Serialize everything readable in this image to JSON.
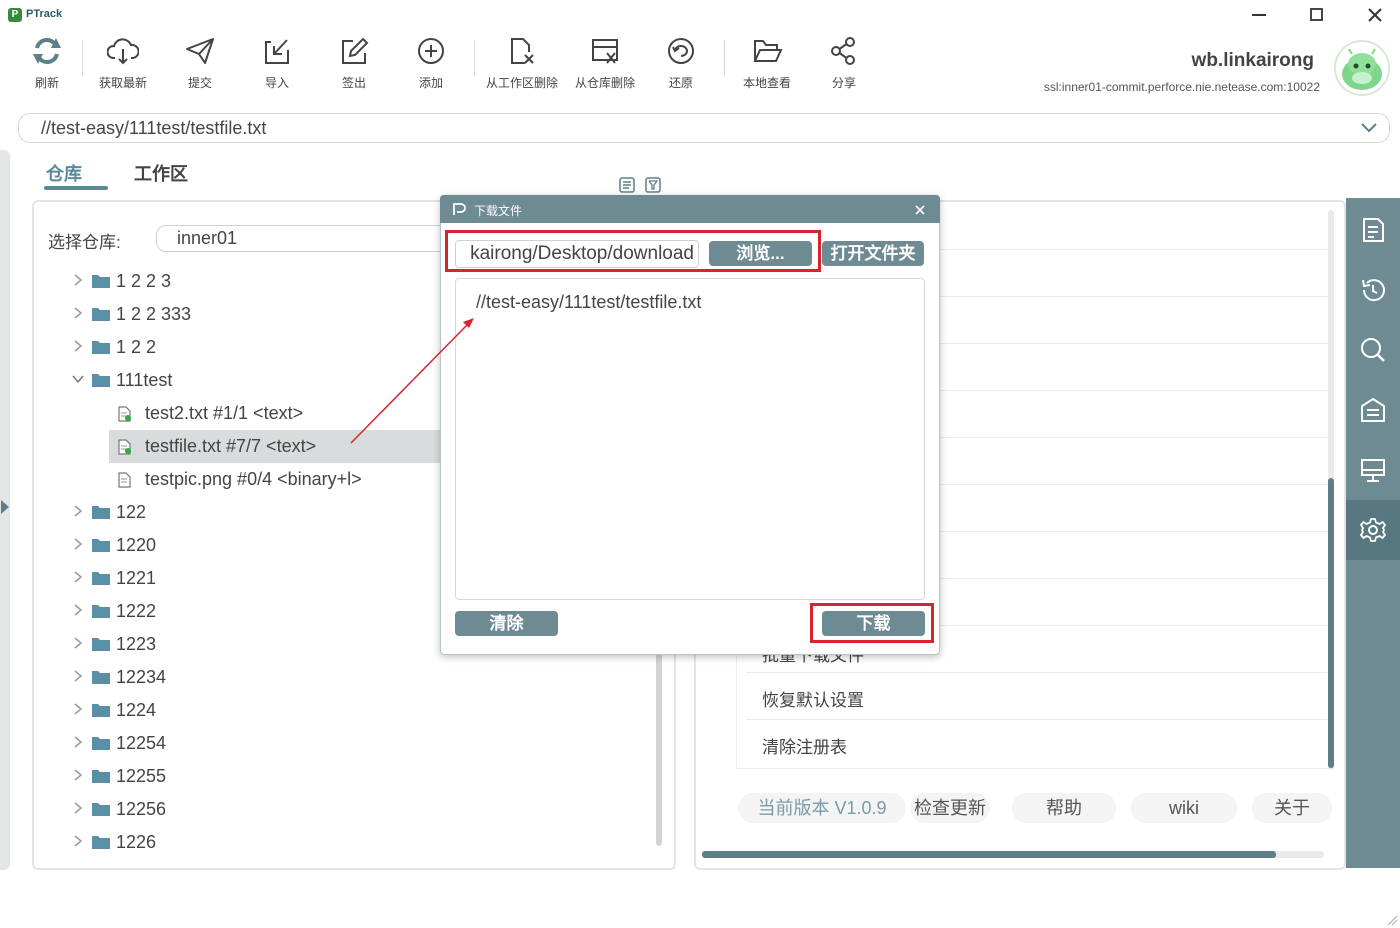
{
  "app": {
    "name": "PTrack",
    "logo_letter": "P"
  },
  "toolbar": {
    "refresh": "刷新",
    "get_latest": "获取最新",
    "submit": "提交",
    "import": "导入",
    "checkout": "签出",
    "add": "添加",
    "remove_workspace": "从工作区删除",
    "remove_depot": "从仓库删除",
    "revert": "还原",
    "local_view": "本地查看",
    "share": "分享"
  },
  "user": {
    "name": "wb.linkairong",
    "server": "ssl:inner01-commit.perforce.nie.netease.com:10022"
  },
  "path_bar": {
    "value": "//test-easy/111test/testfile.txt"
  },
  "tabs": {
    "depot": "仓库",
    "workspace": "工作区"
  },
  "depot_select": {
    "label": "选择仓库:",
    "value": "inner01"
  },
  "tree": [
    {
      "label": "1 2 2 3",
      "type": "folder",
      "expanded": false
    },
    {
      "label": "1 2 2 333",
      "type": "folder",
      "expanded": false
    },
    {
      "label": "1 2 2",
      "type": "folder",
      "expanded": false
    },
    {
      "label": "111test",
      "type": "folder",
      "expanded": true
    },
    {
      "label": "test2.txt  #1/1 <text>",
      "type": "file"
    },
    {
      "label": "testfile.txt  #7/7 <text>",
      "type": "file",
      "selected": true
    },
    {
      "label": "testpic.png  #0/4 <binary+l>",
      "type": "file"
    },
    {
      "label": "122",
      "type": "folder",
      "expanded": false
    },
    {
      "label": "1220",
      "type": "folder",
      "expanded": false
    },
    {
      "label": "1221",
      "type": "folder",
      "expanded": false
    },
    {
      "label": "1222",
      "type": "folder",
      "expanded": false
    },
    {
      "label": "1223",
      "type": "folder",
      "expanded": false
    },
    {
      "label": "12234",
      "type": "folder",
      "expanded": false
    },
    {
      "label": "1224",
      "type": "folder",
      "expanded": false
    },
    {
      "label": "12254",
      "type": "folder",
      "expanded": false
    },
    {
      "label": "12255",
      "type": "folder",
      "expanded": false
    },
    {
      "label": "12256",
      "type": "folder",
      "expanded": false
    },
    {
      "label": "1226",
      "type": "folder",
      "expanded": false
    }
  ],
  "settings": {
    "partial_item": "批量下载文件",
    "restore_defaults": "恢复默认设置",
    "clear_registry": "清除注册表"
  },
  "footer": {
    "version": "当前版本 V1.0.9",
    "check_update": "检查更新",
    "help": "帮助",
    "wiki": "wiki",
    "about": "关于"
  },
  "dialog": {
    "title": "下载文件",
    "save_path": "kairong/Desktop/download",
    "browse": "浏览...",
    "open_folder": "打开文件夹",
    "files": [
      "//test-easy/111test/testfile.txt"
    ],
    "clear": "清除",
    "download": "下载"
  },
  "colors": {
    "accent": "#6e8a92",
    "highlight": "#d9232d",
    "selected_row": "#d9dcdc",
    "folder": "#5a8fa5"
  }
}
